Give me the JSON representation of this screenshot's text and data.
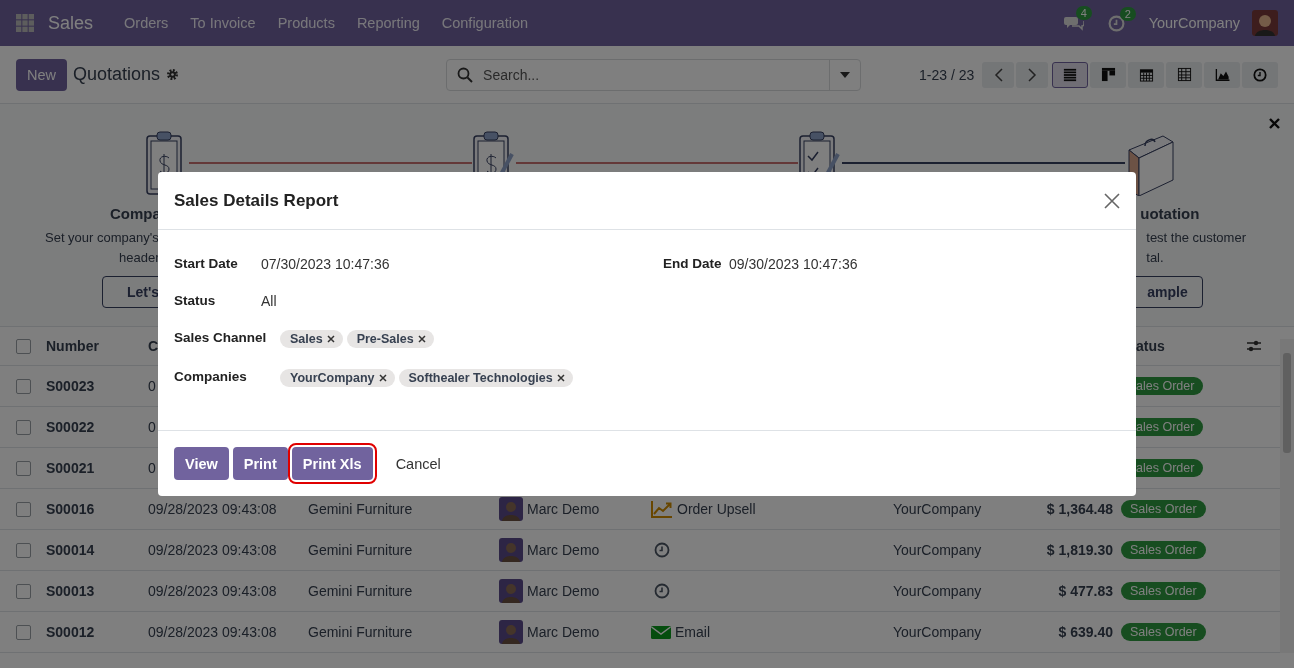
{
  "navbar": {
    "app": "Sales",
    "menu": [
      "Orders",
      "To Invoice",
      "Products",
      "Reporting",
      "Configuration"
    ],
    "messages_badge": "4",
    "activities_badge": "2",
    "company": "YourCompany"
  },
  "control_panel": {
    "new_button": "New",
    "title": "Quotations",
    "search": {
      "placeholder": "Search..."
    },
    "pager": "1-23 / 23",
    "views": [
      {
        "kind": "list",
        "selected": true
      },
      {
        "kind": "kanban",
        "selected": false
      },
      {
        "kind": "calendar",
        "selected": false
      },
      {
        "kind": "pivot",
        "selected": false
      },
      {
        "kind": "graph",
        "selected": false
      },
      {
        "kind": "activity",
        "selected": false
      }
    ]
  },
  "onboarding": {
    "left": {
      "title": "Compa",
      "lines": [
        "Set your company's",
        "header"
      ],
      "button": "Let's"
    },
    "right": {
      "title": "uotation",
      "lines": [
        "test the customer",
        "tal."
      ],
      "button": "ample"
    }
  },
  "table": {
    "select_all_checked": false,
    "columns": [
      "Number",
      "C",
      "atus"
    ],
    "rows": [
      {
        "checked": false,
        "number": "S00023",
        "date": "0",
        "status": "ales Order"
      },
      {
        "checked": false,
        "number": "S00022",
        "date": "0",
        "status": "ales Order"
      },
      {
        "checked": false,
        "number": "S00021",
        "date": "0",
        "status": "ales Order"
      },
      {
        "checked": false,
        "number": "S00016",
        "date": "09/28/2023 09:43:08",
        "customer": "Gemini Furniture",
        "salesperson": "Marc Demo",
        "activity": {
          "kind": "upsell",
          "label": "Order Upsell"
        },
        "company": "YourCompany",
        "total": "$ 1,364.48",
        "status": "Sales Order"
      },
      {
        "checked": false,
        "number": "S00014",
        "date": "09/28/2023 09:43:08",
        "customer": "Gemini Furniture",
        "salesperson": "Marc Demo",
        "activity": {
          "kind": "clock"
        },
        "company": "YourCompany",
        "total": "$ 1,819.30",
        "status": "Sales Order"
      },
      {
        "checked": false,
        "number": "S00013",
        "date": "09/28/2023 09:43:08",
        "customer": "Gemini Furniture",
        "salesperson": "Marc Demo",
        "activity": {
          "kind": "clock"
        },
        "company": "YourCompany",
        "total": "$ 477.83",
        "status": "Sales Order"
      },
      {
        "checked": false,
        "number": "S00012",
        "date": "09/28/2023 09:43:08",
        "customer": "Gemini Furniture",
        "salesperson": "Marc Demo",
        "activity": {
          "kind": "email",
          "label": "Email"
        },
        "company": "YourCompany",
        "total": "$ 639.40",
        "status": "Sales Order"
      }
    ]
  },
  "dialog": {
    "title": "Sales Details Report",
    "start_date": {
      "label": "Start Date",
      "value": "07/30/2023 10:47:36"
    },
    "end_date": {
      "label": "End Date",
      "value": "09/30/2023 10:47:36"
    },
    "status": {
      "label": "Status",
      "value": "All"
    },
    "sales_channel": {
      "label": "Sales Channel",
      "tags": [
        "Sales",
        "Pre-Sales"
      ]
    },
    "companies": {
      "label": "Companies",
      "tags": [
        "YourCompany",
        "Softhealer Technologies"
      ]
    },
    "buttons": [
      {
        "label": "View",
        "kind": "primary",
        "highlighted": false
      },
      {
        "label": "Print",
        "kind": "primary",
        "highlighted": false
      },
      {
        "label": "Print Xls",
        "kind": "primary",
        "highlighted": true
      },
      {
        "label": "Cancel",
        "kind": "link",
        "highlighted": false
      }
    ]
  }
}
